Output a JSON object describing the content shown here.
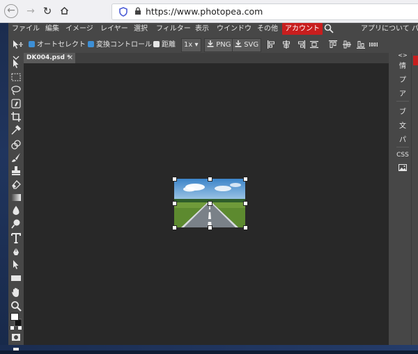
{
  "browser": {
    "url": "https://www.photopea.com",
    "lock": "lock-icon"
  },
  "menu": {
    "items": [
      "ファイル",
      "編集",
      "イメージ",
      "レイヤー",
      "選択",
      "フィルター",
      "表示",
      "ウインドウ",
      "その他"
    ],
    "account": "アカウント",
    "about": "アプリについて",
    "extra": "パ"
  },
  "options": {
    "autoselect_label": "オートセレクト",
    "transform_label": "変換コントロール",
    "distance_label": "距離",
    "zoom_value": "1x",
    "png_label": "PNG",
    "svg_label": "SVG"
  },
  "tab": {
    "label": "DK004.psd *",
    "close": "✕"
  },
  "right_panel": {
    "top_label": "<>",
    "items": [
      "情",
      "プ",
      "ア",
      "ブ",
      "文",
      "パ",
      "CSS"
    ]
  },
  "colors": {
    "account": "#c81e1e",
    "checkbox_on": "#3d8fd6",
    "canvas_bg": "#282828",
    "panel_bg": "#474747"
  }
}
